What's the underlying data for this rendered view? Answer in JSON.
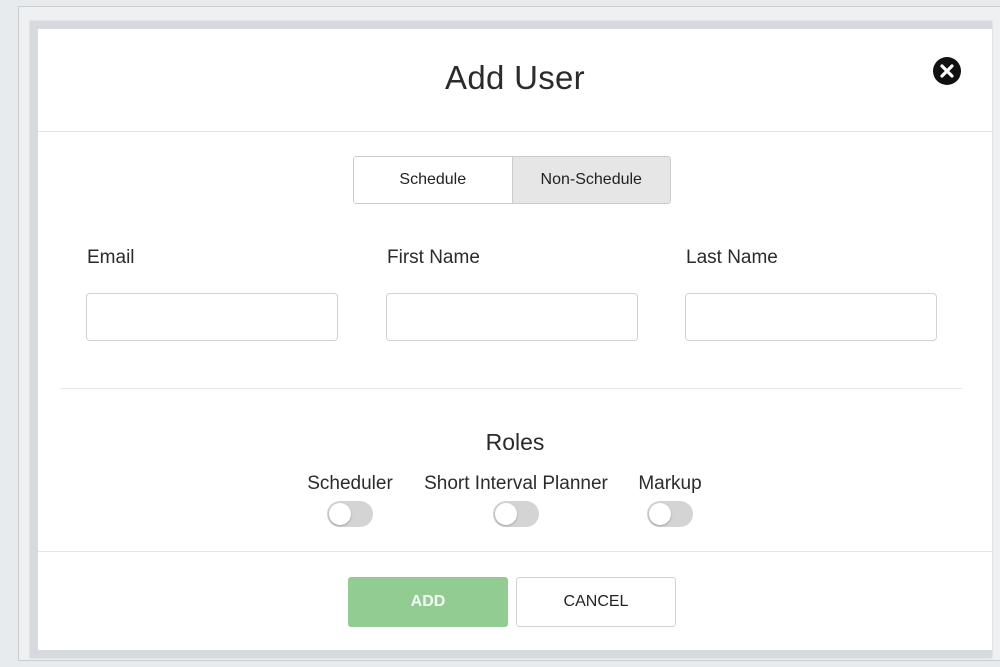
{
  "modal": {
    "title": "Add User",
    "close_icon": "close-circle-icon"
  },
  "user_type_toggle": {
    "options": [
      "Schedule",
      "Non-Schedule"
    ],
    "selected": "Non-Schedule"
  },
  "fields": {
    "email": {
      "label": "Email",
      "value": "",
      "placeholder": ""
    },
    "first_name": {
      "label": "First Name",
      "value": "",
      "placeholder": ""
    },
    "last_name": {
      "label": "Last Name",
      "value": "",
      "placeholder": ""
    }
  },
  "roles": {
    "title": "Roles",
    "items": [
      {
        "label": "Scheduler",
        "enabled": false
      },
      {
        "label": "Short Interval Planner",
        "enabled": false
      },
      {
        "label": "Markup",
        "enabled": false
      }
    ]
  },
  "actions": {
    "add_label": "ADD",
    "cancel_label": "CANCEL"
  },
  "colors": {
    "add_button": "#93cc93",
    "toggle_active": "#e6e6e6",
    "switch_off": "#d4d4d4"
  }
}
